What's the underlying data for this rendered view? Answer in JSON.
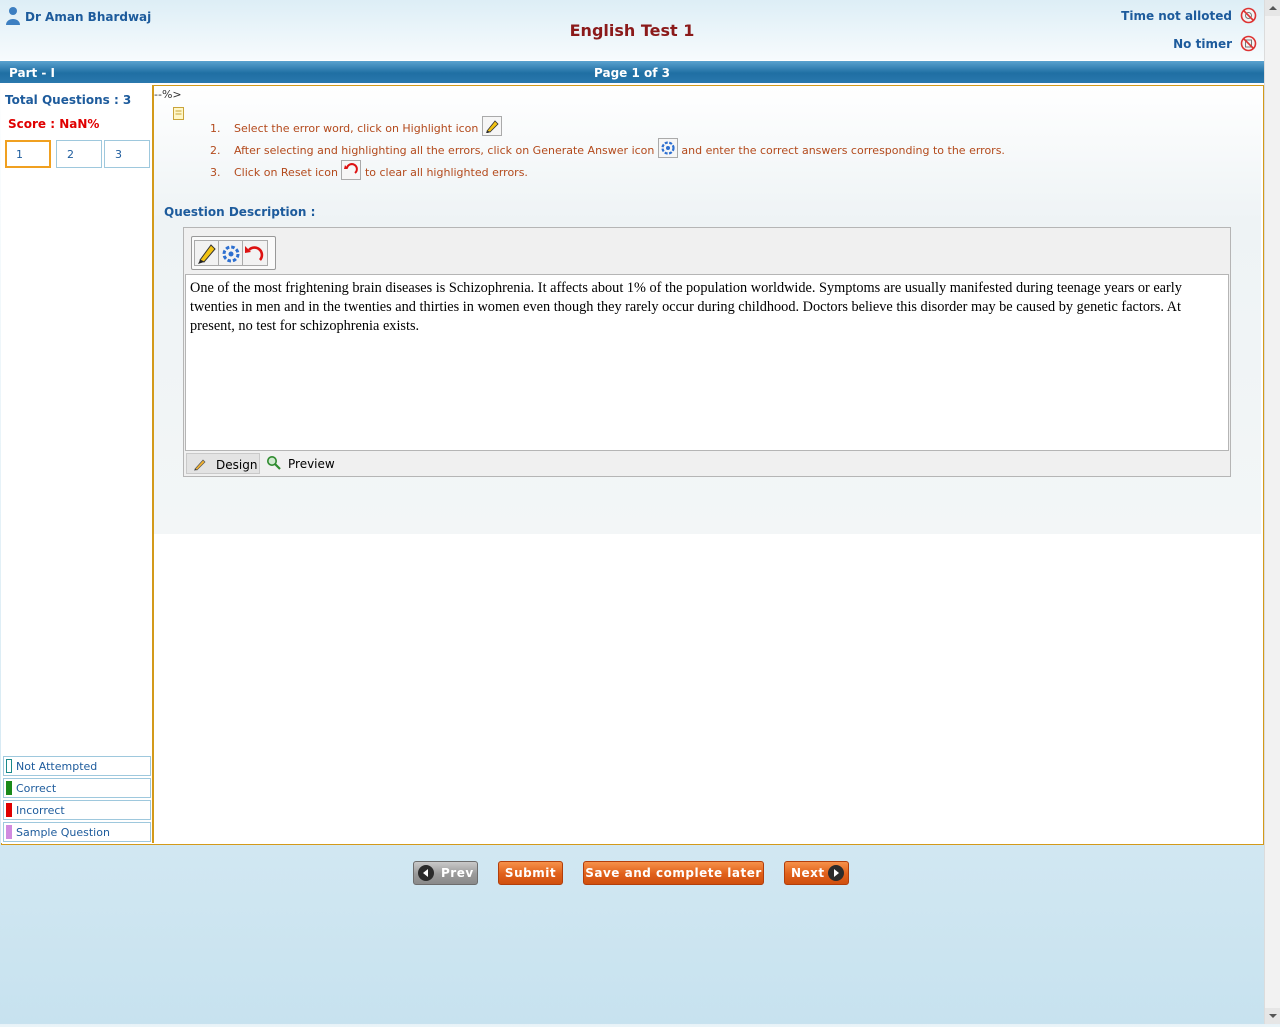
{
  "header": {
    "user_name": "Dr Aman Bhardwaj",
    "title": "English Test 1",
    "time_status": "Time not alloted",
    "timer_status": "No timer"
  },
  "part_bar": {
    "part": "Part - I",
    "page": "Page 1 of 3"
  },
  "sidebar": {
    "total_questions": "Total Questions : 3",
    "score": "Score : NaN%",
    "questions": [
      "1",
      "2",
      "3"
    ],
    "active_question": "1",
    "legend": [
      {
        "label": "Not Attempted",
        "color": "#ffffff"
      },
      {
        "label": "Correct",
        "color": "#1a8a1a"
      },
      {
        "label": "Incorrect",
        "color": "#e00000"
      },
      {
        "label": "Sample Question",
        "color": "#d18be0"
      }
    ]
  },
  "content": {
    "stray_text": "--%>",
    "instructions": [
      {
        "num": "1.",
        "before": "Select the error word, click on Highlight icon",
        "after": ""
      },
      {
        "num": "2.",
        "before": "After selecting and highlighting all the errors, click on Generate Answer icon",
        "after": "and enter the correct answers corresponding to the errors."
      },
      {
        "num": "3.",
        "before": "Click on Reset icon",
        "after": "to clear all highlighted errors."
      }
    ],
    "question_label": "Question Description :",
    "passage": "One of the most frightening brain diseases is Schizophrenia. It affects about 1% of the population worldwide. Symptoms are usually manifested during teenage years or early twenties in men and in the twenties and thirties in women even though they rarely occur during childhood. Doctors believe this disorder may be caused by genetic factors. At present, no test for schizophrenia exists.",
    "tabs": {
      "design": "Design",
      "preview": "Preview"
    }
  },
  "buttons": {
    "prev": "Prev",
    "submit": "Submit",
    "save": "Save and complete later",
    "next": "Next"
  },
  "colors": {
    "accent_blue": "#1d5b9c",
    "title_red": "#8b1a1a",
    "frame_orange": "#d39a1a",
    "button_orange": "#e0601a"
  }
}
